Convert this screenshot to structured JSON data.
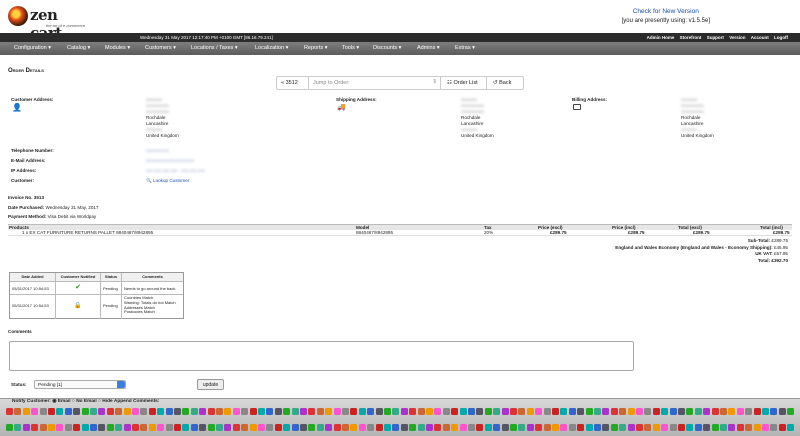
{
  "header": {
    "logo_name": "zen cart",
    "logo_tagline": "the art of e-commerce",
    "check_version_link": "Check for New Version",
    "version_text": "[you are presently using: v1.5.5e]",
    "datetime": "Wednesday 31 May 2017 12:17:40 PM +0100 GMT [86.16.79.241]",
    "top_links": [
      "Admin Home",
      "Storefront",
      "Support",
      "Version",
      "Account",
      "Logoff"
    ]
  },
  "menu": [
    "Configuration",
    "Catalog",
    "Modules",
    "Customers",
    "Locations / Taxes",
    "Localization",
    "Reports",
    "Tools",
    "Discounts",
    "Admins",
    "Extras"
  ],
  "page_title": "Order Details",
  "jump": {
    "order_number": "« 3512",
    "placeholder": "Jump to Order:",
    "order_list": "Order List",
    "back": "Back"
  },
  "customer_address": {
    "label": "Customer Address:",
    "lines": [
      "xxxxxxx",
      "xxxxxxxxxx",
      "xxxxxxxxxx",
      "Rochdale",
      "Lancashire",
      "xxxxxxx",
      "United Kingdom"
    ]
  },
  "shipping_address": {
    "label": "Shipping Address:",
    "lines": [
      "xxxxxxx",
      "xxxxxxxxxx",
      "xxxxxxxxxx",
      "Rochdale",
      "Lancashire",
      "xxxxxxx",
      "United Kingdom"
    ]
  },
  "billing_address": {
    "label": "Billing Address:",
    "lines": [
      "xxxxxxx",
      "xxxxxxxxxx",
      "xxxxxxxxxx",
      "Rochdale",
      "Lancashire",
      "xxxxxxx",
      "United Kingdom"
    ]
  },
  "contact": {
    "telephone_label": "Telephone Number:",
    "telephone_value": "xxxxxxxxxx",
    "email_label": "E-Mail Address:",
    "email_value": "xxxxxxxxxxxxxxxxxxxxx",
    "ip_label": "IP Address:",
    "ip_value": "xxx.xxx.xxx.xxx - xxx.xxx.xxx",
    "customer_label": "Customer:",
    "lookup": "Lookup Customer"
  },
  "invoice": {
    "invoice_no": "Invoice No. 3513",
    "date_label": "Date Purchased:",
    "date_value": "Wednesday 31 May, 2017",
    "payment_label": "Payment Method:",
    "payment_value": "Visa Debit via Worldpay"
  },
  "products_table": {
    "headers": [
      "Products",
      "Model",
      "Tax",
      "Price (excl)",
      "Price (incl)",
      "Total (excl)",
      "Total (incl)"
    ],
    "rows": [
      {
        "product": "1 x EX CAT FURNITURE RETURNS PALLET 8840467/8942895",
        "model": "8840467/8942895",
        "tax": "20%",
        "price_excl": "£289.75",
        "price_incl": "£289.75",
        "total_excl": "£289.75",
        "total_incl": "£289.75"
      }
    ]
  },
  "totals": [
    {
      "label": "Sub-Total:",
      "value": "£289.75"
    },
    {
      "label": "England and Wales Economy (England and Wales - Economy Shipping):",
      "value": "£45.95"
    },
    {
      "label": "UK VAT:",
      "value": "£57.95"
    },
    {
      "label": "Total:",
      "value": "£392.70"
    }
  ],
  "history": {
    "headers": [
      "Date Added",
      "Customer Notified",
      "Status",
      "Comments"
    ],
    "rows": [
      {
        "date": "05/31/2017 10:54:53",
        "notified": "check",
        "status": "Pending",
        "comments": "Needs to go around the back"
      },
      {
        "date": "05/31/2017 10:54:53",
        "notified": "lock",
        "status": "Pending",
        "comments": "Countries Match\nWarning: Totals do not Match\nAddresses Match\nPostcodes Match"
      }
    ]
  },
  "comments_label": "Comments",
  "status": {
    "label": "Status:",
    "value": "Pending [1]",
    "update": "update"
  },
  "notify": {
    "text": "Notify Customer:",
    "email": "Email",
    "no_email": "No Email",
    "hide": "Hide",
    "append": "Append Comments:"
  }
}
